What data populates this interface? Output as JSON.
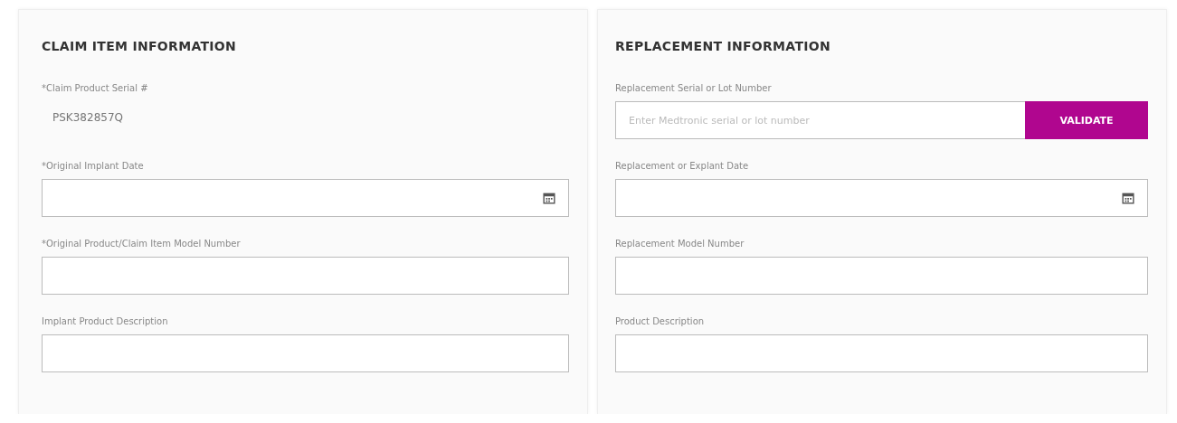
{
  "panels": [
    {
      "title": "CLAIM ITEM INFORMATION",
      "fields": [
        {
          "kind": "static",
          "label": "*Claim Product Serial #",
          "value": "PSK382857Q"
        },
        {
          "kind": "date",
          "label": "*Original Implant Date"
        },
        {
          "kind": "text",
          "label": "*Original Product/Claim Item Model Number"
        },
        {
          "kind": "text",
          "label": "Implant Product Description"
        }
      ]
    },
    {
      "title": "REPLACEMENT INFORMATION",
      "fields": [
        {
          "kind": "validate",
          "label": "Replacement Serial or Lot Number",
          "placeholder": "Enter Medtronic serial or lot number",
          "button": "VALIDATE"
        },
        {
          "kind": "date",
          "label": "Replacement or Explant Date"
        },
        {
          "kind": "text",
          "label": "Replacement Model Number"
        },
        {
          "kind": "text",
          "label": "Product Description"
        }
      ]
    }
  ]
}
